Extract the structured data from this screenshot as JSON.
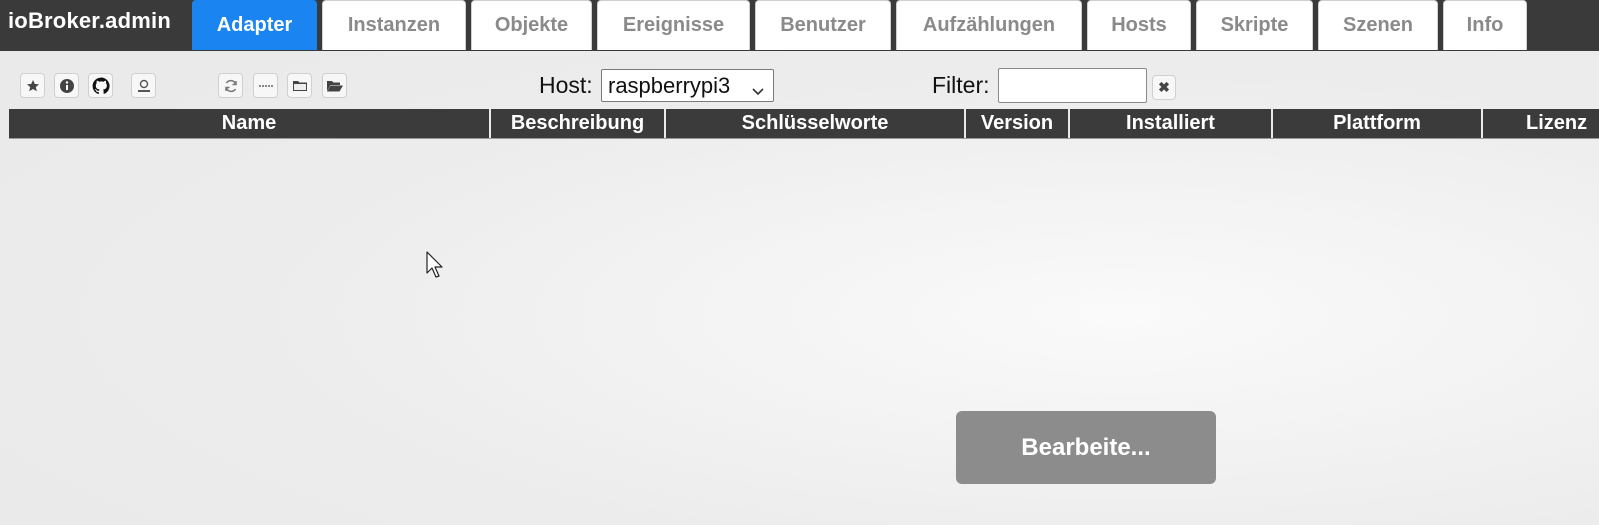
{
  "app": {
    "title": "ioBroker.admin"
  },
  "tabs": [
    {
      "label": "Adapter",
      "active": true
    },
    {
      "label": "Instanzen"
    },
    {
      "label": "Objekte"
    },
    {
      "label": "Ereignisse"
    },
    {
      "label": "Benutzer"
    },
    {
      "label": "Aufzählungen"
    },
    {
      "label": "Hosts"
    },
    {
      "label": "Skripte"
    },
    {
      "label": "Szenen"
    },
    {
      "label": "Info"
    }
  ],
  "toolbar": {
    "icons": [
      "star-icon",
      "info-icon",
      "github-icon",
      "user-icon",
      "refresh-icon",
      "list-icon",
      "folder-icon",
      "folder-open-icon"
    ],
    "host_label": "Host:",
    "host_value": "raspberrypi3",
    "filter_label": "Filter:",
    "filter_value": "",
    "clear_symbol": "✖"
  },
  "table": {
    "columns": [
      "Name",
      "Beschreibung",
      "Schlüsselworte",
      "Version",
      "Installiert",
      "Plattform",
      "Lizenz"
    ]
  },
  "overlay": {
    "message": "Bearbeite..."
  },
  "colors": {
    "topbar": "#3a3a3a",
    "active_tab": "#1a84f0",
    "table_header": "#3b3b3b",
    "busy_overlay": "#8c8c8c"
  }
}
